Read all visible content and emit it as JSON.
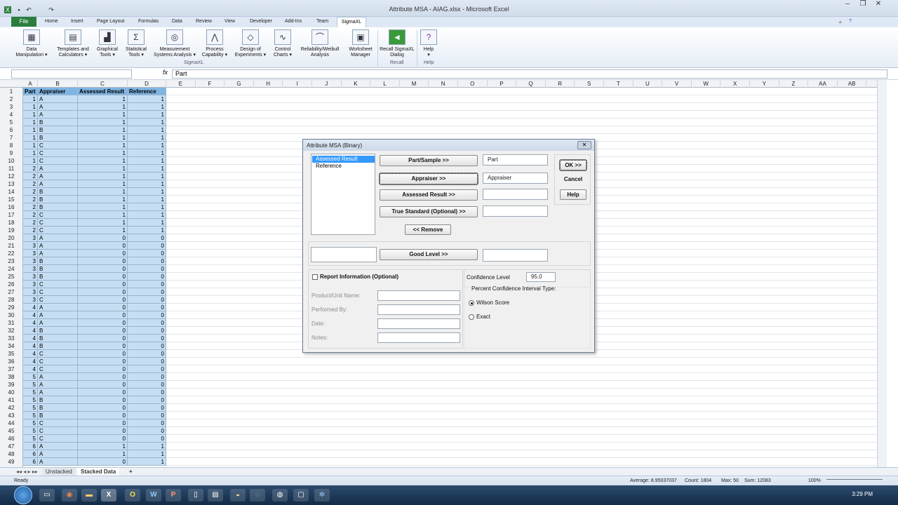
{
  "window": {
    "title": "Attribute MSA - AIAG.xlsx - Microsoft Excel"
  },
  "ribbon_tabs": [
    "Home",
    "Insert",
    "Page Layout",
    "Formulas",
    "Data",
    "Review",
    "View",
    "Developer",
    "Add-Ins",
    "Team"
  ],
  "file_tab": "File",
  "active_tab": "SigmaXL",
  "ribbon": {
    "buttons": [
      {
        "l1": "Data",
        "l2": "Manipulation ▾",
        "icon": "table-icon"
      },
      {
        "l1": "Templates and",
        "l2": "Calculators ▾",
        "icon": "calculator-icon"
      },
      {
        "l1": "Graphical",
        "l2": "Tools ▾",
        "icon": "chart-icon"
      },
      {
        "l1": "Statistical",
        "l2": "Tools ▾",
        "icon": "stats-icon"
      },
      {
        "l1": "Measurement",
        "l2": "Systems Analysis ▾",
        "icon": "target-icon"
      },
      {
        "l1": "Process",
        "l2": "Capability ▾",
        "icon": "capability-icon"
      },
      {
        "l1": "Design of",
        "l2": "Experiments ▾",
        "icon": "doe-icon"
      },
      {
        "l1": "Control",
        "l2": "Charts ▾",
        "icon": "control-chart-icon"
      },
      {
        "l1": "Reliability/Weibull",
        "l2": "Analysis",
        "icon": "weibull-icon"
      },
      {
        "l1": "Worksheet",
        "l2": "Manager",
        "icon": "worksheet-icon"
      },
      {
        "l1": "Recall SigmaXL",
        "l2": "Dialog",
        "icon": "recall-icon"
      },
      {
        "l1": "Help",
        "l2": "▾",
        "icon": "help-icon"
      }
    ],
    "groups": [
      "SigmaXL",
      "Recall",
      "Help"
    ]
  },
  "formula_bar": {
    "fx": "fx",
    "value": "Part"
  },
  "columns": [
    "A",
    "B",
    "C",
    "D",
    "E",
    "F",
    "G",
    "H",
    "I",
    "J",
    "K",
    "L",
    "M",
    "N",
    "O",
    "P",
    "Q",
    "R",
    "S",
    "T",
    "U",
    "V",
    "W",
    "X",
    "Y",
    "Z",
    "AA",
    "AB"
  ],
  "row_numbers": [
    "1",
    "2",
    "3",
    "4",
    "5",
    "6",
    "7",
    "8",
    "9",
    "10",
    "11",
    "12",
    "13",
    "14",
    "15",
    "16",
    "17",
    "18",
    "19",
    "20",
    "21",
    "22",
    "23",
    "24",
    "25",
    "26",
    "27",
    "28",
    "29",
    "30",
    "31",
    "32",
    "33",
    "34",
    "35",
    "36",
    "37",
    "38",
    "39",
    "40",
    "41",
    "42",
    "43",
    "44",
    "45",
    "46",
    "47",
    "48",
    "49"
  ],
  "sheet": {
    "headers": [
      "Part",
      "Appraiser",
      "Assessed Result",
      "Reference"
    ],
    "rows": [
      [
        "1",
        "A",
        "1",
        "1"
      ],
      [
        "1",
        "A",
        "1",
        "1"
      ],
      [
        "1",
        "A",
        "1",
        "1"
      ],
      [
        "1",
        "B",
        "1",
        "1"
      ],
      [
        "1",
        "B",
        "1",
        "1"
      ],
      [
        "1",
        "B",
        "1",
        "1"
      ],
      [
        "1",
        "C",
        "1",
        "1"
      ],
      [
        "1",
        "C",
        "1",
        "1"
      ],
      [
        "1",
        "C",
        "1",
        "1"
      ],
      [
        "2",
        "A",
        "1",
        "1"
      ],
      [
        "2",
        "A",
        "1",
        "1"
      ],
      [
        "2",
        "A",
        "1",
        "1"
      ],
      [
        "2",
        "B",
        "1",
        "1"
      ],
      [
        "2",
        "B",
        "1",
        "1"
      ],
      [
        "2",
        "B",
        "1",
        "1"
      ],
      [
        "2",
        "C",
        "1",
        "1"
      ],
      [
        "2",
        "C",
        "1",
        "1"
      ],
      [
        "2",
        "C",
        "1",
        "1"
      ],
      [
        "3",
        "A",
        "0",
        "0"
      ],
      [
        "3",
        "A",
        "0",
        "0"
      ],
      [
        "3",
        "A",
        "0",
        "0"
      ],
      [
        "3",
        "B",
        "0",
        "0"
      ],
      [
        "3",
        "B",
        "0",
        "0"
      ],
      [
        "3",
        "B",
        "0",
        "0"
      ],
      [
        "3",
        "C",
        "0",
        "0"
      ],
      [
        "3",
        "C",
        "0",
        "0"
      ],
      [
        "3",
        "C",
        "0",
        "0"
      ],
      [
        "4",
        "A",
        "0",
        "0"
      ],
      [
        "4",
        "A",
        "0",
        "0"
      ],
      [
        "4",
        "A",
        "0",
        "0"
      ],
      [
        "4",
        "B",
        "0",
        "0"
      ],
      [
        "4",
        "B",
        "0",
        "0"
      ],
      [
        "4",
        "B",
        "0",
        "0"
      ],
      [
        "4",
        "C",
        "0",
        "0"
      ],
      [
        "4",
        "C",
        "0",
        "0"
      ],
      [
        "4",
        "C",
        "0",
        "0"
      ],
      [
        "5",
        "A",
        "0",
        "0"
      ],
      [
        "5",
        "A",
        "0",
        "0"
      ],
      [
        "5",
        "A",
        "0",
        "0"
      ],
      [
        "5",
        "B",
        "0",
        "0"
      ],
      [
        "5",
        "B",
        "0",
        "0"
      ],
      [
        "5",
        "B",
        "0",
        "0"
      ],
      [
        "5",
        "C",
        "0",
        "0"
      ],
      [
        "5",
        "C",
        "0",
        "0"
      ],
      [
        "5",
        "C",
        "0",
        "0"
      ],
      [
        "6",
        "A",
        "1",
        "1"
      ],
      [
        "6",
        "A",
        "1",
        "1"
      ],
      [
        "6",
        "A",
        "0",
        "1"
      ]
    ]
  },
  "sheet_tabs": [
    "Unstacked",
    "Stacked Data"
  ],
  "status": {
    "ready": "Ready",
    "average": "Average: 8.95037037",
    "count": "Count: 1804",
    "max": "Max: 50",
    "sum": "Sum: 12083",
    "zoom": "100%"
  },
  "clock": "3:29 PM",
  "dialog": {
    "title": "Attribute MSA (Binary)",
    "variables": [
      "Assessed Result",
      "Reference"
    ],
    "btn_part": "Part/Sample >>",
    "btn_appraiser": "Appraiser >>",
    "btn_assessed": "Assessed Result >>",
    "btn_true": "True Standard (Optional) >>",
    "btn_remove": "<< Remove",
    "btn_good": "Good Level >>",
    "val_part": "Part",
    "val_appraiser": "Appraiser",
    "val_assessed": "",
    "val_true": "",
    "val_good": "",
    "ok": "OK >>",
    "cancel": "Cancel",
    "help": "Help",
    "report_info": "Report Information (Optional)",
    "product": "Product/Unit Name:",
    "performed": "Performed By:",
    "date": "Date:",
    "notes": "Notes:",
    "conf_label": "Confidence Level",
    "conf_value": "95.0",
    "ci_type": "Percent Confidence Interval Type:",
    "wilson": "Wilson Score",
    "exact": "Exact"
  }
}
